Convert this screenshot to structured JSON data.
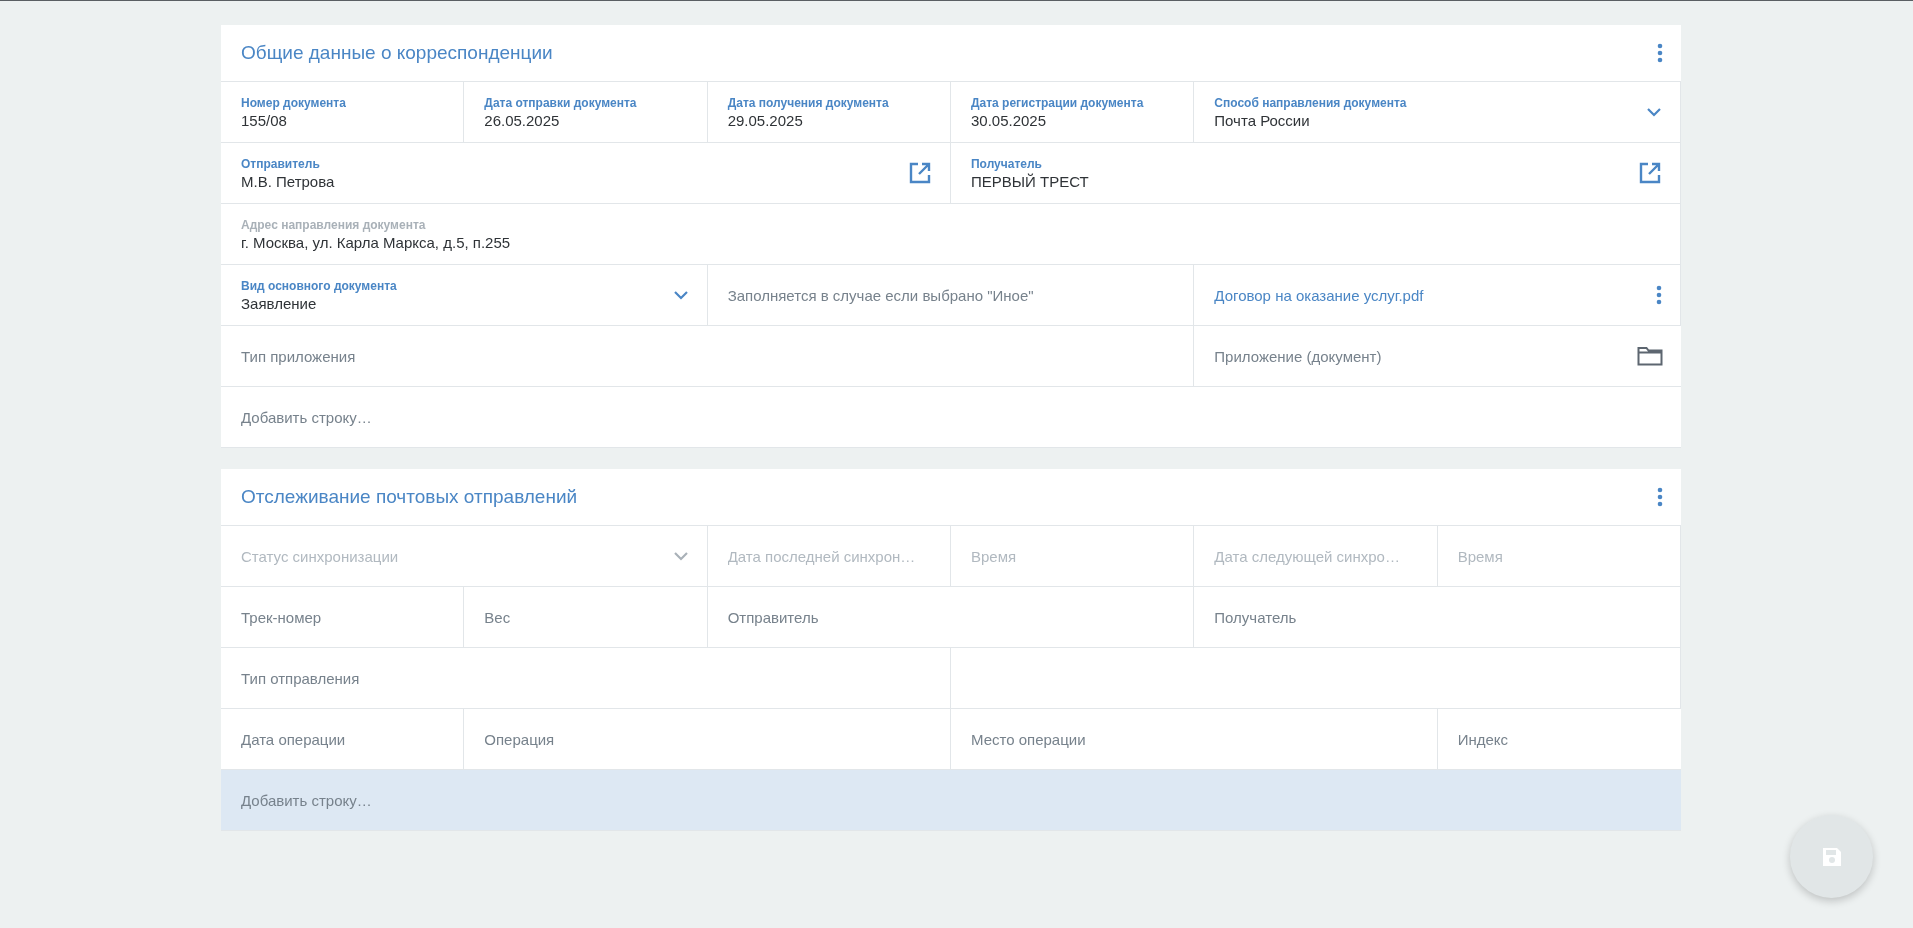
{
  "sections": [
    {
      "title": "Общие данные о корреспонденции",
      "fields": [
        {
          "kind": "field",
          "label": "Номер документа",
          "value": "155/08",
          "disabled": false
        },
        {
          "kind": "field",
          "label": "Дата отправки документа",
          "value": "26.05.2025",
          "disabled": false
        },
        {
          "kind": "field",
          "label": "Дата получения документа",
          "value": "29.05.2025",
          "disabled": false
        },
        {
          "kind": "field",
          "label": "Дата регистрации документа",
          "value": "30.05.2025",
          "disabled": false
        },
        {
          "kind": "select",
          "label": "Способ направления документа",
          "value": "Почта России",
          "disabled": false
        },
        {
          "kind": "contact",
          "label": "Отправитель",
          "value": "М.В. Петрова",
          "disabled": false
        },
        {
          "kind": "contact",
          "label": "Получатель",
          "value": "ПЕРВЫЙ ТРЕСТ",
          "disabled": false
        },
        {
          "kind": "field",
          "label": "Адрес направления документа",
          "value": "г. Москва, ул. Карла Маркса, д.5, п.255",
          "disabled": true
        },
        {
          "kind": "select",
          "label": "Вид основного документа",
          "value": "Заявление",
          "disabled": false
        },
        {
          "kind": "input",
          "placeholder": "Заполняется в случае если выбрано \"Иное\"",
          "disabled": false
        },
        {
          "kind": "file",
          "text": "Договор на оказание услуг.pdf"
        },
        {
          "kind": "input",
          "placeholder": "Тип приложения",
          "disabled": false
        },
        {
          "kind": "upload",
          "placeholder": "Приложение (документ)",
          "disabled": false
        }
      ],
      "add_row": {
        "label": "Добавить строку…",
        "hovered": false
      }
    },
    {
      "title": "Отслеживание почтовых отправлений",
      "fields": [
        {
          "kind": "select-input",
          "placeholder": "Статус синхронизации",
          "disabled": true
        },
        {
          "kind": "input",
          "placeholder": "Дата последней синхрон…",
          "disabled": true
        },
        {
          "kind": "input",
          "placeholder": "Время",
          "disabled": true
        },
        {
          "kind": "input",
          "placeholder": "Дата следующей синхро…",
          "disabled": true
        },
        {
          "kind": "input",
          "placeholder": "Время",
          "disabled": true
        },
        {
          "kind": "input",
          "placeholder": "Трек-номер",
          "disabled": false
        },
        {
          "kind": "input",
          "placeholder": "Вес",
          "disabled": false
        },
        {
          "kind": "input",
          "placeholder": "Отправитель",
          "disabled": false
        },
        {
          "kind": "input",
          "placeholder": "Получатель",
          "disabled": false
        },
        {
          "kind": "input",
          "placeholder": "Тип отправления",
          "disabled": false
        },
        {
          "kind": "empty"
        },
        {
          "kind": "input",
          "placeholder": "Дата операции",
          "disabled": false
        },
        {
          "kind": "input",
          "placeholder": "Операция",
          "disabled": false
        },
        {
          "kind": "input",
          "placeholder": "Место операции",
          "disabled": false
        },
        {
          "kind": "input",
          "placeholder": "Индекс",
          "disabled": false
        }
      ],
      "add_row": {
        "label": "Добавить строку…",
        "hovered": true
      }
    }
  ],
  "save_button": {
    "disabled": true
  }
}
